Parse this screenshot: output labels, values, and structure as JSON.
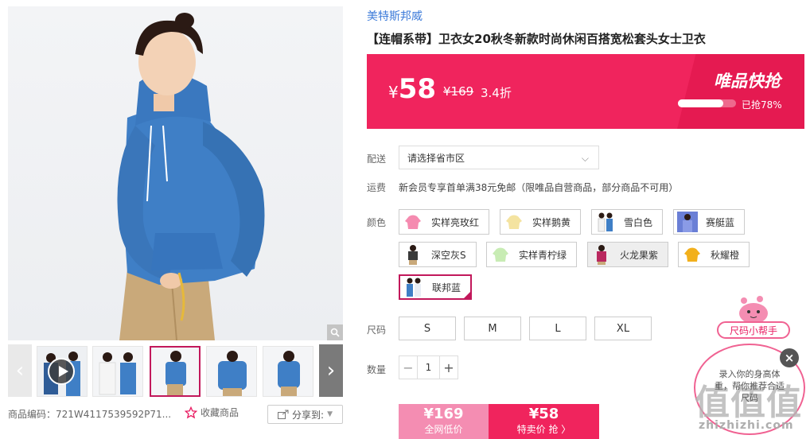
{
  "gallery": {
    "zoom_icon": "magnifier-icon",
    "prev_icon": "chevron-left-icon",
    "next_icon": "chevron-right-icon",
    "play_icon": "play-icon"
  },
  "product": {
    "sku_label": "商品编码：",
    "sku_value": "721W4117539592P71...",
    "favorite_label": "收藏商品",
    "share_label": "分享到:",
    "brand": "美特斯邦威",
    "title": "【连帽系带】卫衣女20秋冬新款时尚休闲百搭宽松套头女士卫衣"
  },
  "price_banner": {
    "currency": "¥",
    "price": "58",
    "original_price": "¥169",
    "discount": "3.4折",
    "flash_label": "唯品快抢",
    "sold_fraction": 0.78,
    "sold_text": "已抢78%",
    "colors": {
      "main": "#f0245d",
      "accent": "#e51a51"
    }
  },
  "delivery": {
    "label": "配送",
    "placeholder": "请选择省市区"
  },
  "freight": {
    "label": "运费",
    "text": "新会员专享首单满38元免邮（限唯品自营商品，部分商品不可用）"
  },
  "colors": {
    "label": "颜色",
    "options": [
      {
        "label": "实样亮玫红",
        "swatch": "#f58bb0"
      },
      {
        "label": "实样鹅黄",
        "swatch": "#f4e3a0"
      },
      {
        "label": "雪白色",
        "swatch": "#f2f2f2"
      },
      {
        "label": "赛艇蓝",
        "swatch": "#6a7fd6"
      },
      {
        "label": "深空灰S",
        "swatch": "#3a3a3a"
      },
      {
        "label": "实样青柠绿",
        "swatch": "#c8ecb4"
      },
      {
        "label": "火龙果紫",
        "swatch": "#b9285f"
      },
      {
        "label": "秋耀橙",
        "swatch": "#f2b01c"
      },
      {
        "label": "联邦蓝",
        "swatch": "#3f7fc6"
      }
    ],
    "selected": "联邦蓝",
    "hovered": "火龙果紫"
  },
  "sizes": {
    "label": "尺码",
    "options": [
      "S",
      "M",
      "L",
      "XL"
    ]
  },
  "quantity": {
    "label": "数量",
    "value": "1",
    "minus_icon": "minus-icon",
    "plus_icon": "plus-icon"
  },
  "buy": {
    "market_price": "¥169",
    "market_label": "全网低价",
    "special_price": "¥58",
    "special_label": "特卖价 抢 〉"
  },
  "size_helper": {
    "label": "尺码小帮手",
    "bubble_text": "录入你的身高体重，帮你推荐合适尺码",
    "close_icon": "close-icon"
  },
  "watermark": {
    "logo": "值值值",
    "text": "zhizhizhi.com"
  }
}
